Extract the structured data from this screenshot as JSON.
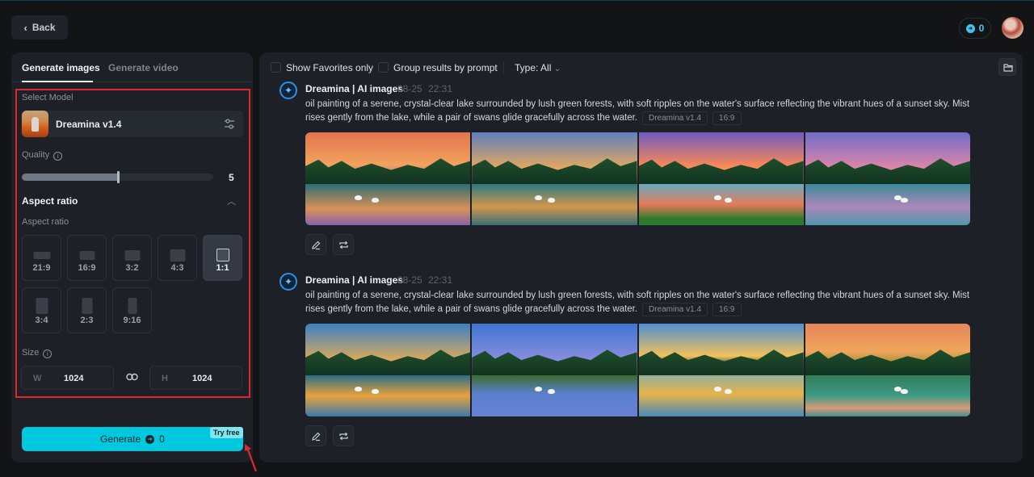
{
  "header": {
    "back_label": "Back",
    "credits": "0"
  },
  "left_panel": {
    "tabs": [
      {
        "label": "Generate images",
        "active": true
      },
      {
        "label": "Generate video",
        "active": false
      }
    ],
    "select_model_label": "Select Model",
    "model_name": "Dreamina v1.4",
    "quality_label": "Quality",
    "quality_value": "5",
    "quality_fraction": 0.5,
    "aspect_section_title": "Aspect ratio",
    "aspect_label": "Aspect ratio",
    "aspect_ratios": [
      {
        "label": "21:9",
        "active": false
      },
      {
        "label": "16:9",
        "active": false
      },
      {
        "label": "3:2",
        "active": false
      },
      {
        "label": "4:3",
        "active": false
      },
      {
        "label": "1:1",
        "active": true
      },
      {
        "label": "3:4",
        "active": false
      },
      {
        "label": "2:3",
        "active": false
      },
      {
        "label": "9:16",
        "active": false
      }
    ],
    "size_label": "Size",
    "width_prefix": "W",
    "width_value": "1024",
    "height_prefix": "H",
    "height_value": "1024",
    "generate_label": "Generate",
    "generate_cost": "0",
    "try_free_badge": "Try free"
  },
  "filters": {
    "show_favorites_label": "Show Favorites only",
    "group_by_prompt_label": "Group results by prompt",
    "type_label": "Type: All"
  },
  "results": [
    {
      "title": "Dreamina | AI images",
      "date": "08-25",
      "time": "22:31",
      "prompt": "oil painting of a serene, crystal-clear lake surrounded by lush green forests, with soft ripples on the water's surface reflecting the vibrant hues of a sunset sky. Mist rises gently from the lake, while a pair of swans glide gracefully across the water.",
      "model_chip": "Dreamina v1.4",
      "ratio_chip": "16:9",
      "images": [
        "sunset-lake-swans-painting-1",
        "sunset-lake-swans-painting-2",
        "sunset-lake-swans-painting-3",
        "sunset-lake-swans-painting-4"
      ]
    },
    {
      "title": "Dreamina | AI images",
      "date": "08-25",
      "time": "22:31",
      "prompt": "oil painting of a serene, crystal-clear lake surrounded by lush green forests, with soft ripples on the water's surface reflecting the vibrant hues of a sunset sky. Mist rises gently from the lake, while a pair of swans glide gracefully across the water.",
      "model_chip": "Dreamina v1.4",
      "ratio_chip": "16:9",
      "images": [
        "golden-hour-lake-1",
        "morning-lake-swans-2",
        "sunrise-mist-lake-3",
        "sunset-teal-lake-4"
      ]
    }
  ],
  "colors": {
    "accent": "#00c8de",
    "highlight_box": "#e0262f",
    "background": "#131416",
    "panel": "#1d2027"
  }
}
